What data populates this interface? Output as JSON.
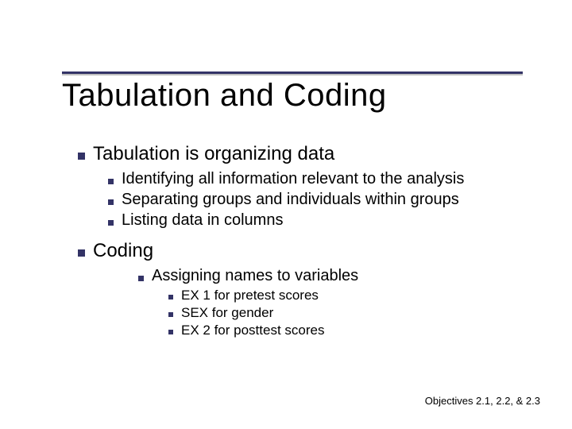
{
  "title": "Tabulation and Coding",
  "points": {
    "p1": "Tabulation is organizing data",
    "p1a": "Identifying all information relevant to the analysis",
    "p1b": "Separating groups and individuals within groups",
    "p1c": "Listing data in columns",
    "p2": "Coding",
    "p2a": "Assigning names to variables",
    "p2a1": "EX 1 for pretest scores",
    "p2a2": "SEX for gender",
    "p2a3": "EX 2 for posttest scores"
  },
  "footer": "Objectives 2.1, 2.2, & 2.3"
}
